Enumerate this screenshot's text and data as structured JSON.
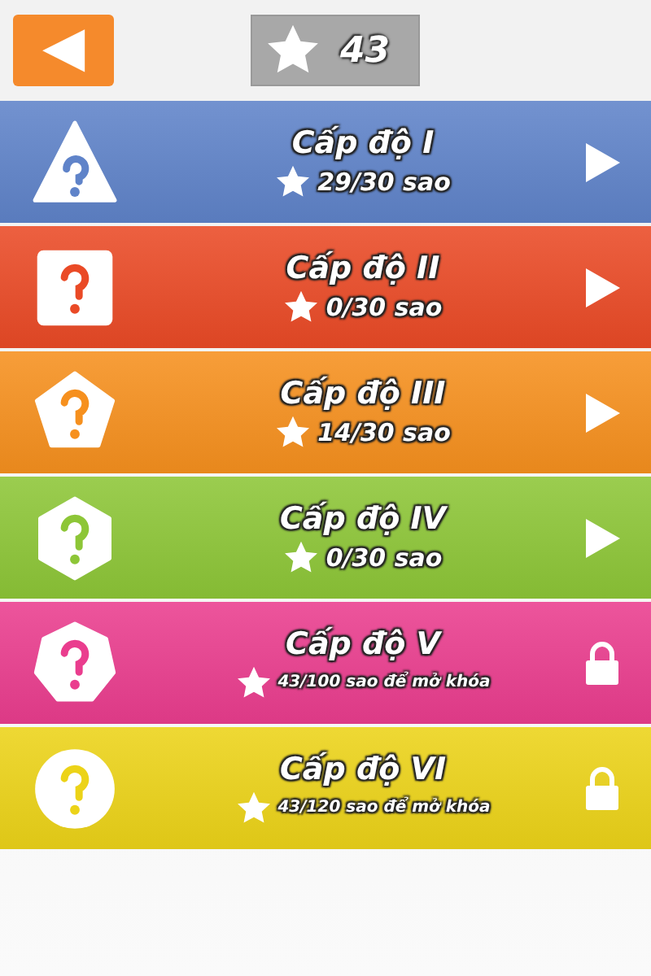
{
  "top_bar": {
    "back_button": "◀",
    "total_stars": "43"
  },
  "levels": [
    {
      "title": "Cấp độ I",
      "progress": "29/30 sao",
      "locked": false,
      "color": "#5f83c9"
    },
    {
      "title": "Cấp độ II",
      "progress": "0/30 sao",
      "locked": false,
      "color": "#ea4a26"
    },
    {
      "title": "Cấp độ III",
      "progress": "14/30 sao",
      "locked": false,
      "color": "#f6901e"
    },
    {
      "title": "Cấp độ IV",
      "progress": "0/30 sao",
      "locked": false,
      "color": "#8dc637"
    },
    {
      "title": "Cấp độ V",
      "progress": "43/100 sao để mở khóa",
      "locked": true,
      "color": "#ea3d8e"
    },
    {
      "title": "Cấp độ VI",
      "progress": "43/120 sao để mở khóa",
      "locked": true,
      "color": "#ecd318"
    }
  ]
}
